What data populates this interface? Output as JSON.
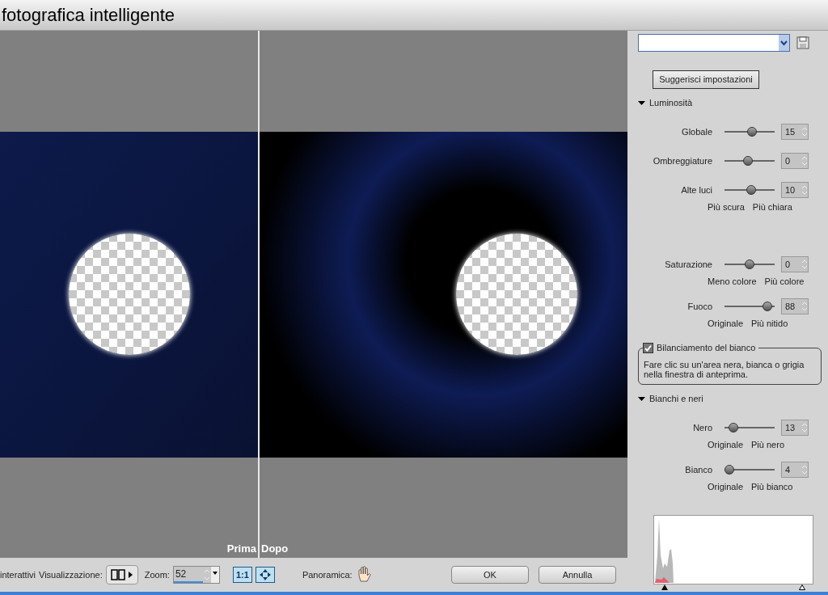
{
  "window": {
    "title": "fotografica intelligente"
  },
  "preview": {
    "before_label": "Prima",
    "after_label": "Dopo"
  },
  "toolbar": {
    "cut_label": "interattivi",
    "view_label": "Visualizzazione:",
    "zoom_label": "Zoom:",
    "zoom_value": "52",
    "one_to_one": "1:1",
    "pan_label": "Panoramica:",
    "ok": "OK",
    "cancel": "Annulla"
  },
  "panel": {
    "suggest_button": "Suggerisci impostazioni",
    "items": [
      {
        "kind": "section",
        "label": "Luminosità",
        "expanded": true
      },
      {
        "kind": "slider",
        "label": "Globale",
        "level": 0.55,
        "value": "15"
      },
      {
        "kind": "slider",
        "label": "Ombreggiature",
        "level": 0.47,
        "value": "0"
      },
      {
        "kind": "slider",
        "label": "Alte luci",
        "level": 0.54,
        "value": "10"
      },
      {
        "kind": "range",
        "left": "Più scura",
        "right": "Più chiara"
      },
      {
        "kind": "spacer"
      },
      {
        "kind": "slider",
        "label": "Saturazione",
        "level": 0.5,
        "value": "0"
      },
      {
        "kind": "range",
        "left": "Meno colore",
        "right": "Più colore"
      },
      {
        "kind": "slider",
        "label": "Fuoco",
        "level": 0.85,
        "value": "88"
      },
      {
        "kind": "range",
        "left": "Originale",
        "right": "Più nitido"
      },
      {
        "kind": "checkgroup",
        "label": "Bilanciamento del bianco",
        "checked": true,
        "text": "Fare clic su un'area nera, bianca o grigia nella finestra di anteprima."
      },
      {
        "kind": "section",
        "label": "Bianchi e neri",
        "expanded": true
      },
      {
        "kind": "slider",
        "label": "Nero",
        "level": 0.18,
        "value": "13"
      },
      {
        "kind": "range",
        "left": "Originale",
        "right": "Più nero"
      },
      {
        "kind": "slider",
        "label": "Bianco",
        "level": 0.1,
        "value": "4"
      },
      {
        "kind": "range",
        "left": "Originale",
        "right": "Più bianco"
      }
    ]
  }
}
